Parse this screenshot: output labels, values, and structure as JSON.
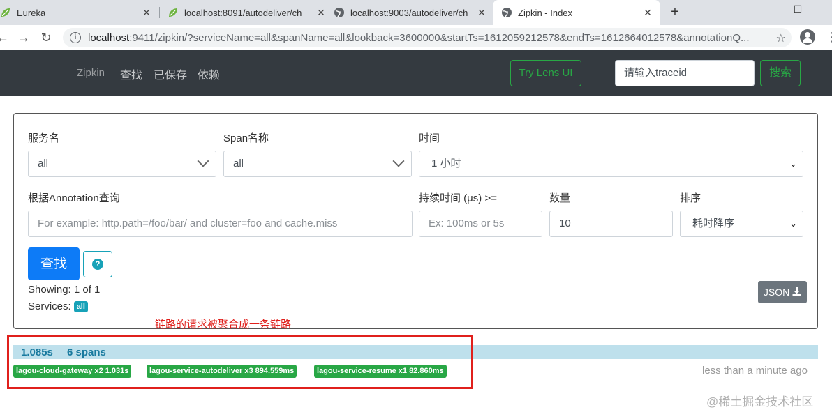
{
  "browser": {
    "tabs": [
      {
        "title": "Eureka",
        "icon": "spring-leaf-icon"
      },
      {
        "title": "localhost:8091/autodeliver/ch",
        "icon": "spring-leaf-icon"
      },
      {
        "title": "localhost:9003/autodeliver/ch",
        "icon": "globe-icon"
      },
      {
        "title": "Zipkin - Index",
        "icon": "globe-icon"
      }
    ],
    "url_host": "localhost",
    "url_rest": ":9411/zipkin/?serviceName=all&spanName=all&lookback=3600000&startTs=1612059212578&endTs=1612664012578&annotationQ..."
  },
  "navbar": {
    "brand": "Zipkin",
    "links": [
      "查找",
      "已保存",
      "依赖"
    ],
    "lens_button": "Try Lens UI",
    "trace_placeholder": "请输入traceid",
    "search_button": "搜索"
  },
  "search": {
    "service_label": "服务名",
    "service_value": "all",
    "span_label": "Span名称",
    "span_value": "all",
    "time_label": "时间",
    "time_value": "1 小时",
    "annotation_label": "根据Annotation查询",
    "annotation_placeholder": "For example: http.path=/foo/bar/ and cluster=foo and cache.miss",
    "duration_label": "持续时间 (μs) >=",
    "duration_placeholder": "Ex: 100ms or 5s",
    "limit_label": "数量",
    "limit_value": "10",
    "sort_label": "排序",
    "sort_value": "耗时降序",
    "find_button": "查找",
    "help_glyph": "?",
    "showing": "Showing: 1 of 1",
    "services_label": "Services:",
    "services_badge": "all",
    "json_button": "JSON"
  },
  "annotation_note": "链路的请求被聚合成一条链路",
  "result": {
    "duration": "1.085s",
    "spans": "6 spans",
    "services": [
      "lagou-cloud-gateway x2 1.031s",
      "lagou-service-autodeliver x3 894.559ms",
      "lagou-service-resume x1 82.860ms"
    ],
    "age": "less than a minute ago"
  },
  "watermark": "@稀土掘金技术社区",
  "colors": {
    "navbar_bg": "#343a40",
    "success": "#28a745",
    "primary": "#0d7bf7",
    "info": "#17a2b8",
    "result_bar": "#bee0ec",
    "annotation_red": "#e0201c"
  }
}
